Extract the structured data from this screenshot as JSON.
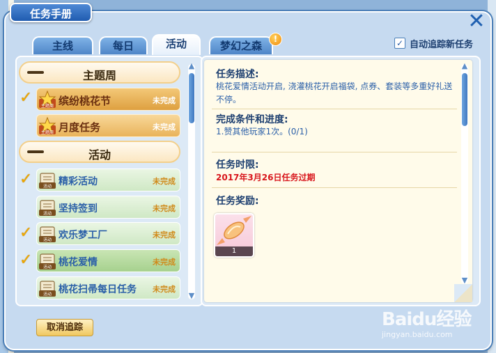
{
  "window": {
    "title": "任务手册",
    "close_icon": "close-icon"
  },
  "tabs": [
    {
      "label": "主线",
      "active": false
    },
    {
      "label": "每日",
      "active": false
    },
    {
      "label": "活动",
      "active": true
    },
    {
      "label": "梦幻之森",
      "active": false,
      "badge": "!"
    }
  ],
  "auto_track": {
    "label": "自动追踪新任务",
    "checked": true,
    "check_glyph": "✓"
  },
  "quest_list": {
    "groups": [
      {
        "label": "主题周",
        "collapse_icon": "minus-icon"
      },
      {
        "label": "活动",
        "collapse_icon": "minus-icon"
      }
    ],
    "items": [
      {
        "name": "缤纷桃花节",
        "status": "未完成",
        "icon": "theme-week-star-icon",
        "icon_label": "主题周",
        "tracked": true,
        "selected": true
      },
      {
        "name": "月度任务",
        "status": "未完成",
        "icon": "theme-week-star-icon",
        "icon_label": "主题周",
        "tracked": false,
        "selected": false
      },
      {
        "name": "精彩活动",
        "status": "未完成",
        "icon": "activity-scroll-icon",
        "icon_label": "活动",
        "tracked": true,
        "selected": false
      },
      {
        "name": "坚持签到",
        "status": "未完成",
        "icon": "activity-scroll-icon",
        "icon_label": "活动",
        "tracked": false,
        "selected": false
      },
      {
        "name": "欢乐梦工厂",
        "status": "未完成",
        "icon": "activity-scroll-icon",
        "icon_label": "活动",
        "tracked": true,
        "selected": false
      },
      {
        "name": "桃花爱情",
        "status": "未完成",
        "icon": "activity-scroll-icon",
        "icon_label": "活动",
        "tracked": true,
        "selected": true
      },
      {
        "name": "桃花扫帚每日任务",
        "status": "未完成",
        "icon": "activity-scroll-icon",
        "icon_label": "活动",
        "tracked": false,
        "selected": false
      }
    ],
    "check_glyph": "✓"
  },
  "detail": {
    "description_title": "任务描述:",
    "description": "桃花爱情活动开启, 浇灌桃花开启福袋, 点券、套装等多重好礼送不停。",
    "conditions_title": "完成条件和进度:",
    "conditions": "1.赞其他玩家1次。(0/1)",
    "time_title": "任务时限:",
    "deadline": "2017年3月26日任务过期",
    "reward_title": "任务奖励:",
    "reward": {
      "icon": "candy-icon",
      "count": "1"
    }
  },
  "cancel_button": "取消追踪",
  "watermark": {
    "brand": "Baidu经验",
    "url": "jingyan.baidu.com"
  },
  "colors": {
    "frame": "#c6daf0",
    "accent_blue": "#2a5fa8",
    "deadline_red": "#d8151b",
    "gold": "#e9b35a",
    "green": "#cfe8c5"
  }
}
